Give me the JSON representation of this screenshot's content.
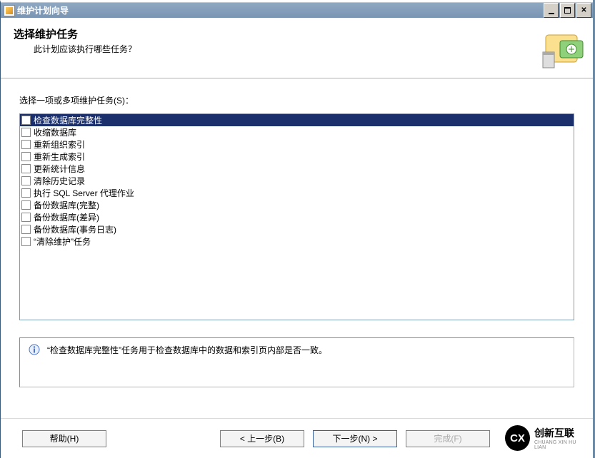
{
  "window": {
    "title": "维护计划向导"
  },
  "header": {
    "heading": "选择维护任务",
    "subheading": "此计划应该执行哪些任务？"
  },
  "body": {
    "instruction": "选择一项或多项维护任务(S)：",
    "tasks": [
      {
        "label": "检查数据库完整性",
        "checked": false,
        "selected": true
      },
      {
        "label": "收缩数据库",
        "checked": false,
        "selected": false
      },
      {
        "label": "重新组织索引",
        "checked": false,
        "selected": false
      },
      {
        "label": "重新生成索引",
        "checked": false,
        "selected": false
      },
      {
        "label": "更新统计信息",
        "checked": false,
        "selected": false
      },
      {
        "label": "清除历史记录",
        "checked": false,
        "selected": false
      },
      {
        "label": "执行 SQL Server 代理作业",
        "checked": false,
        "selected": false
      },
      {
        "label": "备份数据库(完整)",
        "checked": false,
        "selected": false
      },
      {
        "label": "备份数据库(差异)",
        "checked": false,
        "selected": false
      },
      {
        "label": "备份数据库(事务日志)",
        "checked": false,
        "selected": false
      },
      {
        "label": "“清除维护”任务",
        "checked": false,
        "selected": false
      }
    ],
    "description": "“检查数据库完整性”任务用于检查数据库中的数据和索引页内部是否一致。"
  },
  "footer": {
    "help": "帮助(H)",
    "back": "< 上一步(B)",
    "next": "下一步(N) >",
    "finish": "完成(F)"
  },
  "watermark": {
    "logo": "CX",
    "text": "创新互联",
    "sub": "CHUANG XIN HU LIAN"
  }
}
